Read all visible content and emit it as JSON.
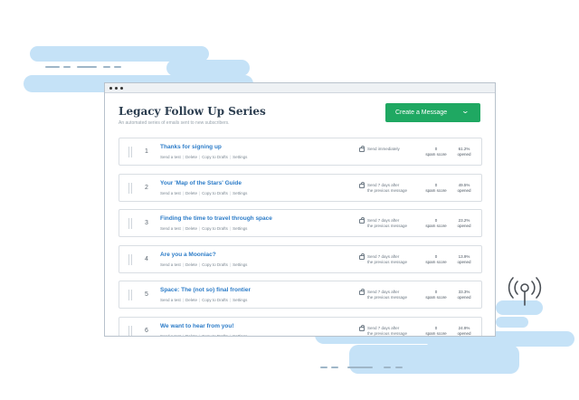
{
  "page": {
    "title": "Legacy Follow Up Series",
    "subtitle": "An automated series of emails sent to new subscribers.",
    "create_button_label": "Create a Message"
  },
  "messages": [
    {
      "number": "1",
      "title": "Thanks for signing up",
      "send_line1": "Send immediately",
      "send_line2": "",
      "spam_value": "0",
      "spam_label": "spam score",
      "opened_value": "61.2%",
      "opened_label": "opened"
    },
    {
      "number": "2",
      "title": "Your 'Map of the Stars' Guide",
      "send_line1": "Send 7 days after",
      "send_line2": "the previous message",
      "spam_value": "0",
      "spam_label": "spam score",
      "opened_value": "49.5%",
      "opened_label": "opened"
    },
    {
      "number": "3",
      "title": "Finding the time to travel through space",
      "send_line1": "Send 7 days after",
      "send_line2": "the previous message",
      "spam_value": "0",
      "spam_label": "spam score",
      "opened_value": "23.2%",
      "opened_label": "opened"
    },
    {
      "number": "4",
      "title": "Are you a Mooniac?",
      "send_line1": "Send 7 days after",
      "send_line2": "the previous message",
      "spam_value": "0",
      "spam_label": "spam score",
      "opened_value": "13.9%",
      "opened_label": "opened"
    },
    {
      "number": "5",
      "title": "Space: The (not so) final frontier",
      "send_line1": "Send 7 days after",
      "send_line2": "the previous message",
      "spam_value": "0",
      "spam_label": "spam score",
      "opened_value": "33.3%",
      "opened_label": "opened"
    },
    {
      "number": "6",
      "title": "We want to hear from you!",
      "send_line1": "Send 7 days after",
      "send_line2": "the previous message",
      "spam_value": "0",
      "spam_label": "spam score",
      "opened_value": "24.9%",
      "opened_label": "opened"
    }
  ],
  "row_actions": {
    "send_test": "Send a test",
    "delete": "Delete",
    "copy_to_drafts": "Copy to Drafts",
    "settings": "Settings"
  },
  "icons": {
    "create_button_dropdown": "chevron-down-icon",
    "schedule": "calendar-icon",
    "decoration": "antenna-icon"
  },
  "colors": {
    "accent_green": "#1fa862",
    "link_blue": "#2c7cc8",
    "cloud_blue": "#c5e2f7"
  }
}
